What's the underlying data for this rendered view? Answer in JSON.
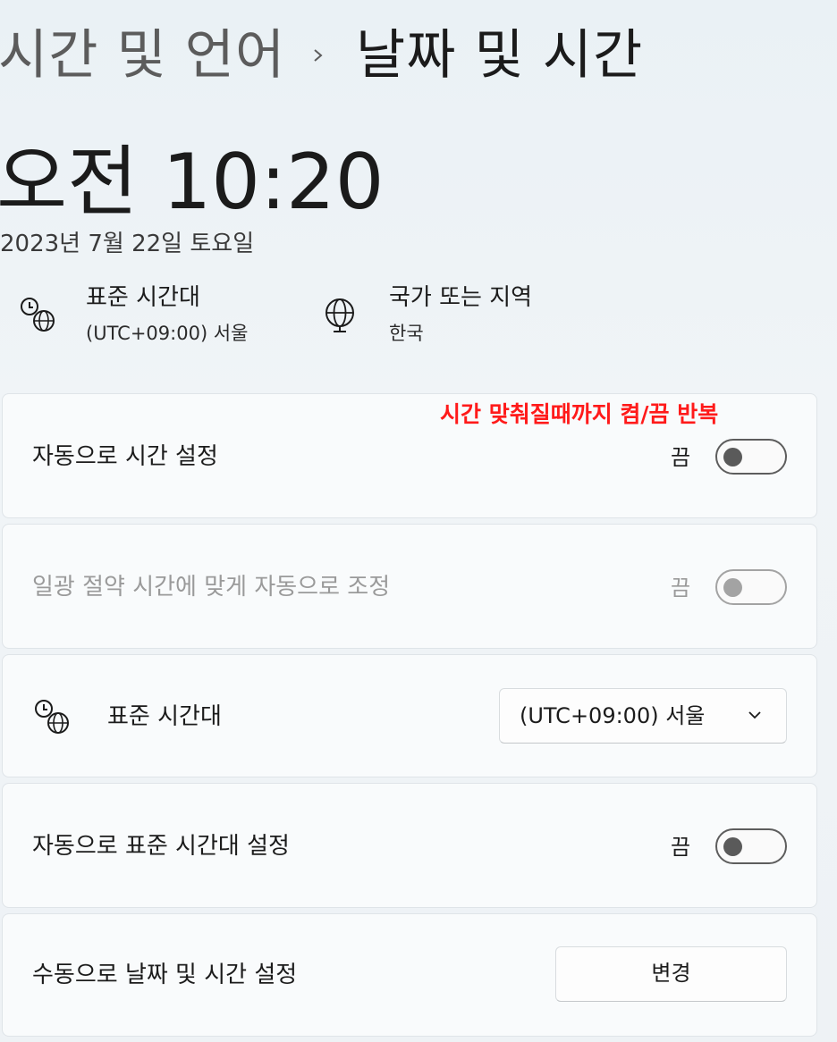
{
  "breadcrumb": {
    "parent": "시간 및 언어",
    "separator_icon": "chevron-right-icon",
    "current": "날짜 및 시간"
  },
  "clock": {
    "time": "오전 10:20",
    "date": "2023년 7월 22일 토요일"
  },
  "info": {
    "timezone": {
      "icon": "clock-globe-icon",
      "title": "표준 시간대",
      "value": "(UTC+09:00) 서울"
    },
    "region": {
      "icon": "globe-icon",
      "title": "국가 또는 지역",
      "value": "한국"
    }
  },
  "annotation": {
    "text": "시간 맞춰질때까지 켬/끔 반복",
    "color": "#ff1a1a"
  },
  "settings": {
    "auto_time": {
      "label": "자동으로 시간 설정",
      "state": "끔",
      "on": false
    },
    "dst": {
      "label": "일광 절약 시간에 맞게 자동으로 조정",
      "state": "끔",
      "on": false,
      "disabled": true
    },
    "timezone": {
      "icon": "clock-globe-icon",
      "label": "표준 시간대",
      "selected": "(UTC+09:00) 서울"
    },
    "auto_timezone": {
      "label": "자동으로 표준 시간대 설정",
      "state": "끔",
      "on": false
    },
    "manual": {
      "label": "수동으로 날짜 및 시간 설정",
      "button": "변경"
    }
  }
}
